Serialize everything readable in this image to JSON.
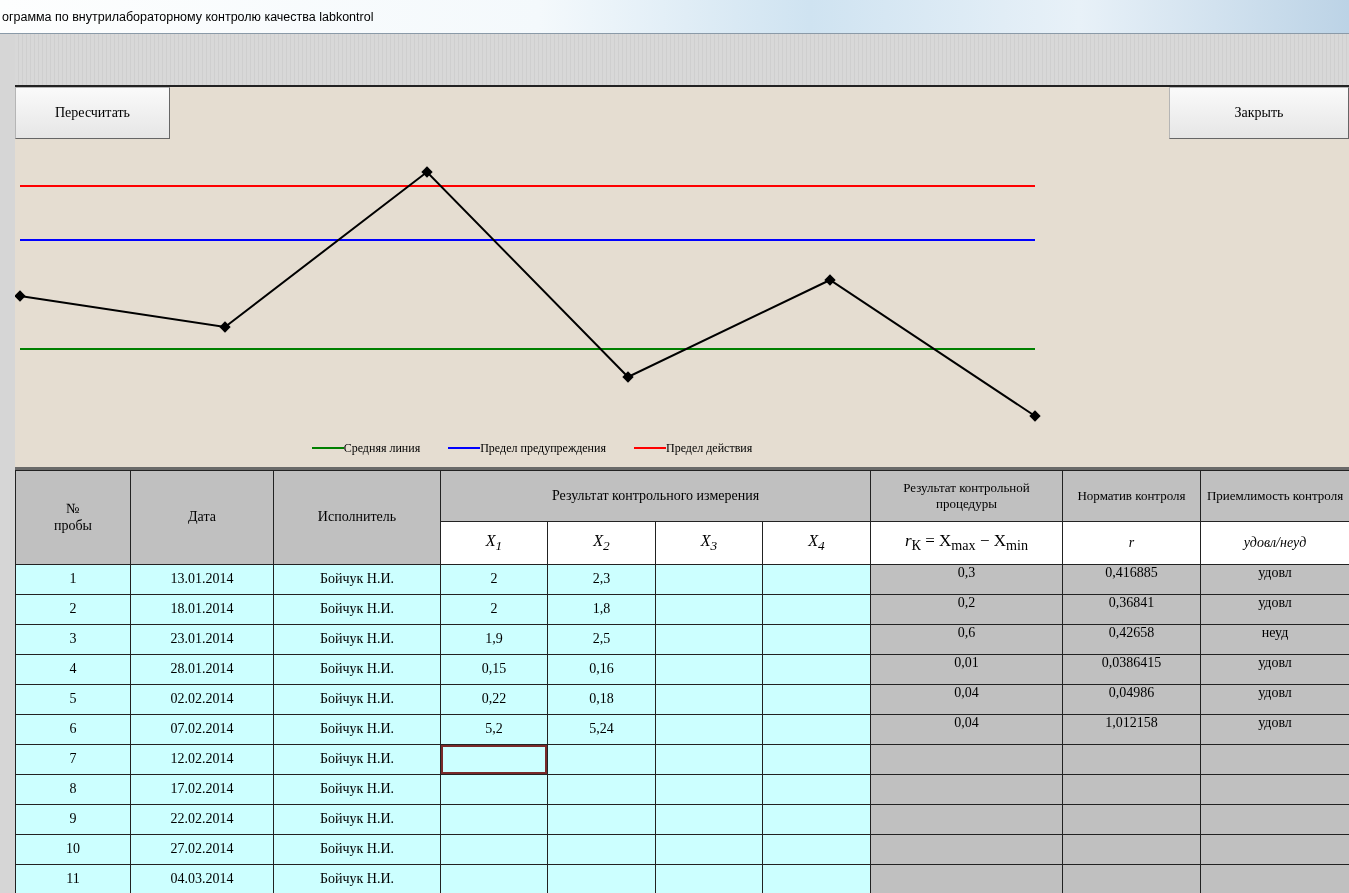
{
  "window": {
    "title": "ограмма по внутрилабораторному контролю качества labkontrol"
  },
  "buttons": [
    {
      "label": "Пересчитать"
    },
    {
      "label": "Закрыть"
    }
  ],
  "chart": {
    "legend": [
      {
        "label": "Средняя линия",
        "color": "#008000"
      },
      {
        "label": "Предел предупреждения",
        "color": "#0000ff"
      },
      {
        "label": "Предел действия",
        "color": "#ff0000"
      }
    ]
  },
  "table": {
    "headers": {
      "no": "№\nпробы",
      "date": "Дата",
      "executor": "Исполнитель",
      "measure": "Результат контрольного измерения",
      "procedure": "Результат контрольной процедуры",
      "norm": "Норматив контроля",
      "accept": "Приемлимость контроля",
      "x": [
        "X$_{1}$",
        "X$_{2}$",
        "X$_{3}$",
        "X$_{4}$"
      ],
      "formula": "*r*$_{К}$ = X$_{max}$ − X$_{min}$",
      "r": "r",
      "verdict": "удовл/неуд"
    },
    "rows": [
      {
        "no": "1",
        "date": "13.01.2014",
        "executor": "Бойчук Н.И.",
        "x": [
          {
            "value": "2",
            "selected": false
          },
          {
            "value": "2,3",
            "selected": false
          },
          {
            "selected": false
          },
          {
            "selected": false
          }
        ],
        "r": "0,3",
        "norm": "0,416885",
        "verdict": "удовл"
      },
      {
        "no": "2",
        "date": "18.01.2014",
        "executor": "Бойчук Н.И.",
        "x": [
          {
            "value": "2",
            "selected": false
          },
          {
            "value": "1,8",
            "selected": false
          },
          {
            "selected": false
          },
          {
            "selected": false
          }
        ],
        "r": "0,2",
        "norm": "0,36841",
        "verdict": "удовл"
      },
      {
        "no": "3",
        "date": "23.01.2014",
        "executor": "Бойчук Н.И.",
        "x": [
          {
            "value": "1,9",
            "selected": false
          },
          {
            "value": "2,5",
            "selected": false
          },
          {
            "selected": false
          },
          {
            "selected": false
          }
        ],
        "r": "0,6",
        "norm": "0,42658",
        "verdict": "неуд"
      },
      {
        "no": "4",
        "date": "28.01.2014",
        "executor": "Бойчук Н.И.",
        "x": [
          {
            "value": "0,15",
            "selected": false
          },
          {
            "value": "0,16",
            "selected": false
          },
          {
            "selected": false
          },
          {
            "selected": false
          }
        ],
        "r": "0,01",
        "norm": "0,0386415",
        "verdict": "удовл"
      },
      {
        "no": "5",
        "date": "02.02.2014",
        "executor": "Бойчук Н.И.",
        "x": [
          {
            "value": "0,22",
            "selected": false
          },
          {
            "value": "0,18",
            "selected": false
          },
          {
            "selected": false
          },
          {
            "selected": false
          }
        ],
        "r": "0,04",
        "norm": "0,04986",
        "verdict": "удовл"
      },
      {
        "no": "6",
        "date": "07.02.2014",
        "executor": "Бойчук Н.И.",
        "x": [
          {
            "value": "5,2",
            "selected": false
          },
          {
            "value": "5,24",
            "selected": false
          },
          {
            "selected": false
          },
          {
            "selected": false
          }
        ],
        "r": "0,04",
        "norm": "1,012158",
        "verdict": "удовл"
      },
      {
        "no": "7",
        "date": "12.02.2014",
        "executor": "Бойчук Н.И.",
        "x": [
          {
            "selected": true
          },
          {
            "selected": false
          },
          {
            "selected": false
          },
          {
            "selected": false
          }
        ]
      },
      {
        "no": "8",
        "date": "17.02.2014",
        "executor": "Бойчук Н.И.",
        "x": [
          {
            "selected": false
          },
          {
            "selected": false
          },
          {
            "selected": false
          },
          {
            "selected": false
          }
        ]
      },
      {
        "no": "9",
        "date": "22.02.2014",
        "executor": "Бойчук Н.И.",
        "x": [
          {
            "selected": false
          },
          {
            "selected": false
          },
          {
            "selected": false
          },
          {
            "selected": false
          }
        ]
      },
      {
        "no": "10",
        "date": "27.02.2014",
        "executor": "Бойчук Н.И.",
        "x": [
          {
            "selected": false
          },
          {
            "selected": false
          },
          {
            "selected": false
          },
          {
            "selected": false
          }
        ]
      },
      {
        "no": "11",
        "date": "04.03.2014",
        "executor": "Бойчук Н.И.",
        "x": [
          {
            "selected": false
          },
          {
            "selected": false
          },
          {
            "selected": false
          },
          {
            "selected": false
          }
        ]
      }
    ]
  }
}
